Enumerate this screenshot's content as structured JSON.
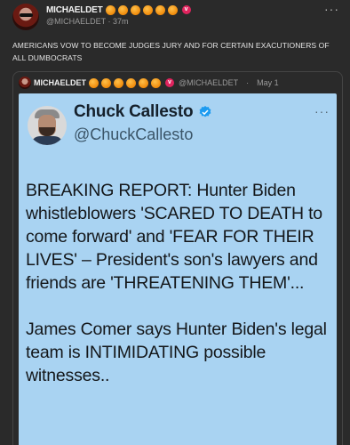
{
  "post": {
    "author": "MICHAELDET",
    "handle": "@MICHAELDET",
    "time": "37m",
    "more": "···",
    "text": "AMERICANS VOW TO BECOME JUDGES JURY AND FOR CERTAIN EXACUTIONERS OF ALL DUMBOCRATS",
    "badge_color": "#f08a0a",
    "verified_color": "#e0245e"
  },
  "quote": {
    "author": "MICHAELDET",
    "handle": "@MICHAELDET",
    "separator": "·",
    "date": "May 1"
  },
  "card": {
    "name": "Chuck Callesto",
    "handle": "@ChuckCallesto",
    "more": "···",
    "background": "#a9d3f2",
    "paragraph1": "BREAKING REPORT: Hunter Biden whistleblowers 'SCARED TO DEATH to come forward' and 'FEAR FOR THEIR LIVES' – President's son's lawyers and friends are 'THREATENING THEM'...",
    "paragraph2": "James Comer says Hunter Biden's legal team is INTIMIDATING possible witnesses.."
  }
}
